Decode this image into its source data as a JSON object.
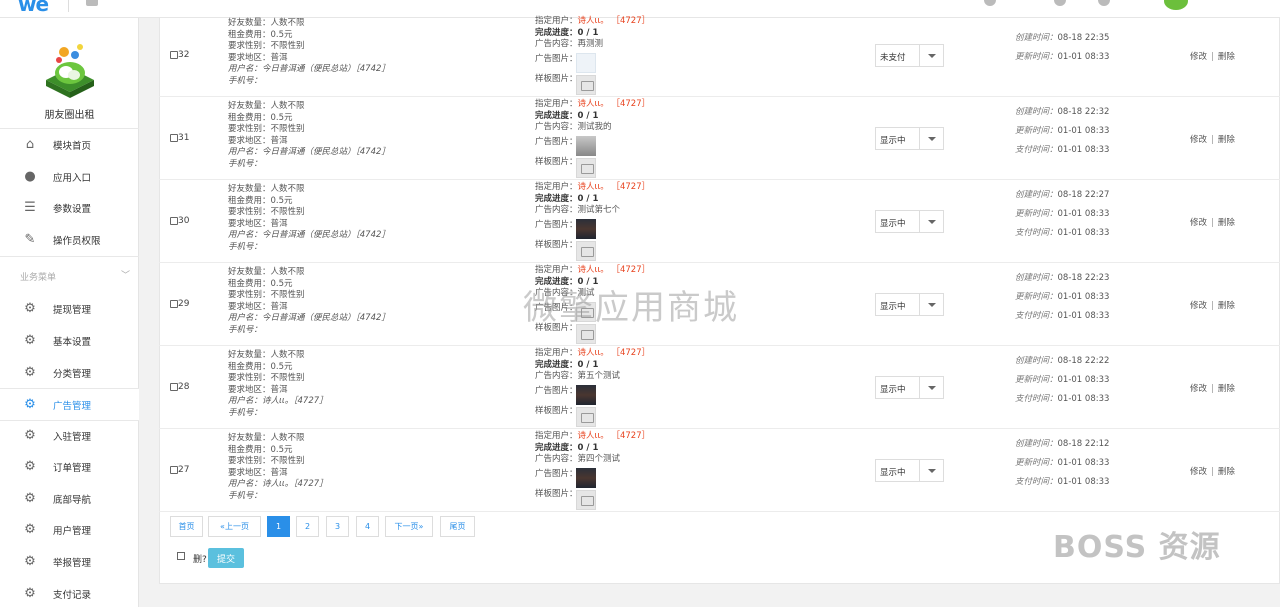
{
  "topbar": {
    "logo_text": "we"
  },
  "sidebar": {
    "app_name": "朋友圈出租",
    "items": [
      {
        "label": "模块首页",
        "icon": "home-icon"
      },
      {
        "label": "应用入口",
        "icon": "chat-icon"
      },
      {
        "label": "参数设置",
        "icon": "list-icon"
      },
      {
        "label": "操作员权限",
        "icon": "edit-icon"
      }
    ],
    "group_title": "业务菜单",
    "group_items": [
      {
        "label": "提现管理",
        "icon": "gear-icon"
      },
      {
        "label": "基本设置",
        "icon": "gear-icon"
      },
      {
        "label": "分类管理",
        "icon": "gear-icon"
      },
      {
        "label": "广告管理",
        "icon": "gear-icon",
        "active": true
      },
      {
        "label": "入驻管理",
        "icon": "gear-icon"
      },
      {
        "label": "订单管理",
        "icon": "gear-icon"
      },
      {
        "label": "底部导航",
        "icon": "gear-icon"
      },
      {
        "label": "用户管理",
        "icon": "gear-icon"
      },
      {
        "label": "举报管理",
        "icon": "gear-icon"
      },
      {
        "label": "支付记录",
        "icon": "gear-icon"
      }
    ]
  },
  "labels": {
    "friends": "好友数量：",
    "fee": "租金费用：",
    "gender": "要求性别：",
    "region": "要求地区：",
    "username": "用户名：",
    "phone": "手机号：",
    "assigned": "指定用户：",
    "progress": "完成进度：",
    "content": "广告内容：",
    "image": "广告图片：",
    "sample": "样板图片：",
    "created": "创建时间：",
    "updated": "更新时间：",
    "paid": "支付时间：",
    "edit": "修改",
    "delete": "删除",
    "op_sep": "|"
  },
  "rows": [
    {
      "id": "32",
      "friends": "人数不限",
      "fee": "0.5元",
      "gender": "不限性别",
      "region": "普洱",
      "username": "今日普洱通（便民总站）［4742］",
      "assigned_name": "诗人ιι。",
      "assigned_id": "［4727］",
      "progress": "0 / 1",
      "content": "再测测",
      "status": "未支付",
      "created": "08-18 22:35",
      "updated": "01-01 08:33",
      "paid": null,
      "ad_image": "doc"
    },
    {
      "id": "31",
      "friends": "人数不限",
      "fee": "0.5元",
      "gender": "不限性别",
      "region": "普洱",
      "username": "今日普洱通（便民总站）［4742］",
      "assigned_name": "诗人ιι。",
      "assigned_id": "［4727］",
      "progress": "0 / 1",
      "content": "测试我的",
      "status": "显示中",
      "created": "08-18 22:32",
      "updated": "01-01 08:33",
      "paid": "01-01 08:33",
      "ad_image": "grey"
    },
    {
      "id": "30",
      "friends": "人数不限",
      "fee": "0.5元",
      "gender": "不限性别",
      "region": "普洱",
      "username": "今日普洱通（便民总站）［4742］",
      "assigned_name": "诗人ιι。",
      "assigned_id": "［4727］",
      "progress": "0 / 1",
      "content": "测试第七个",
      "status": "显示中",
      "created": "08-18 22:27",
      "updated": "01-01 08:33",
      "paid": "01-01 08:33",
      "ad_image": "dark"
    },
    {
      "id": "29",
      "friends": "人数不限",
      "fee": "0.5元",
      "gender": "不限性别",
      "region": "普洱",
      "username": "今日普洱通（便民总站）［4742］",
      "assigned_name": "诗人ιι。",
      "assigned_id": "［4727］",
      "progress": "0 / 1",
      "content": "测试",
      "status": "显示中",
      "created": "08-18 22:23",
      "updated": "01-01 08:33",
      "paid": "01-01 08:33",
      "ad_image": "ph"
    },
    {
      "id": "28",
      "friends": "人数不限",
      "fee": "0.5元",
      "gender": "不限性别",
      "region": "普洱",
      "username": "诗人ιι。［4727］",
      "assigned_name": "诗人ιι。",
      "assigned_id": "［4727］",
      "progress": "0 / 1",
      "content": "第五个测试",
      "status": "显示中",
      "created": "08-18 22:22",
      "updated": "01-01 08:33",
      "paid": "01-01 08:33",
      "ad_image": "dark"
    },
    {
      "id": "27",
      "friends": "人数不限",
      "fee": "0.5元",
      "gender": "不限性别",
      "region": "普洱",
      "username": "诗人ιι。［4727］",
      "assigned_name": "诗人ιι。",
      "assigned_id": "［4727］",
      "progress": "0 / 1",
      "content": "第四个测试",
      "status": "显示中",
      "created": "08-18 22:12",
      "updated": "01-01 08:33",
      "paid": "01-01 08:33",
      "ad_image": "dark"
    }
  ],
  "pagination": {
    "first": "首页",
    "prev": "«上一页",
    "pages": [
      "1",
      "2",
      "3",
      "4"
    ],
    "current": "1",
    "next": "下一页»",
    "last": "尾页"
  },
  "footer": {
    "delete_label": "删?",
    "submit": "提交"
  },
  "watermark": "微擎应用商城",
  "brand_watermark": "BOSS 资源",
  "colors": {
    "accent": "#2a8fe8",
    "danger": "#e8431f",
    "submit": "#5bc0de"
  }
}
